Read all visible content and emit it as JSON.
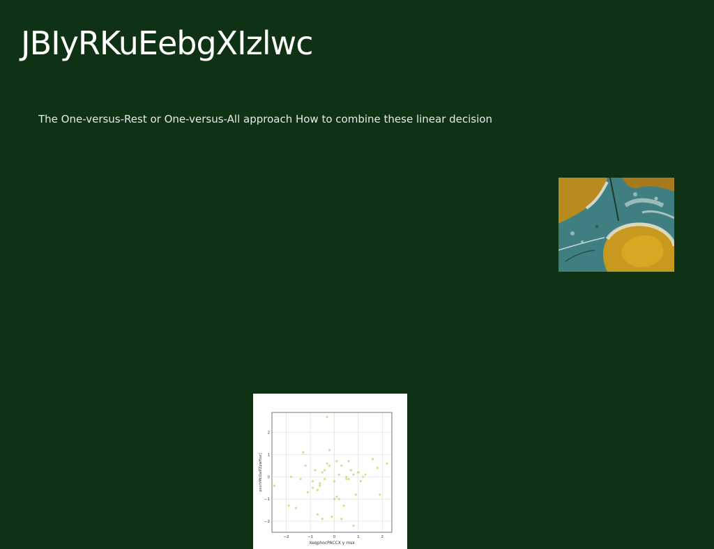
{
  "slide": {
    "title": "JBIyRKuEebgXIzlwc",
    "body": "The One-versus-Rest or One-versus-All approach How to combine these linear decision"
  },
  "photo": {
    "icon": "aerial-landscape-image",
    "colors": {
      "ochre": "#b98a1e",
      "teal": "#3f7f82",
      "white": "#e6ecea",
      "dark": "#1f3a2a"
    }
  },
  "chart_data": {
    "type": "scatter",
    "xlabel": "XeqphocPACCX y msx",
    "ylabel": "pxxrhMcOaiPZpwfhur]",
    "xlim": [
      -2.6,
      2.4
    ],
    "ylim": [
      -2.5,
      2.9
    ],
    "xticks": [
      "−2",
      "−1",
      "0",
      "1",
      "2"
    ],
    "yticks": [
      "−2",
      "−1",
      "0",
      "1",
      "2"
    ],
    "grid": true,
    "marker_color": "#c8dc78",
    "x": [
      -0.3,
      -1.3,
      -0.2,
      0.1,
      0.3,
      0.6,
      0.7,
      1.0,
      1.3,
      1.6,
      2.2,
      -2.5,
      -1.1,
      -0.9,
      -0.6,
      -0.5,
      -0.4,
      -0.2,
      0.0,
      0.2,
      0.5,
      0.8,
      1.1,
      1.8,
      -1.8,
      -1.4,
      -0.8,
      -0.6,
      -0.3,
      0.1,
      0.4,
      0.9,
      -0.1,
      -0.5,
      0.6,
      1.2,
      -1.9,
      -1.6,
      -0.7,
      0.0,
      0.3,
      0.8,
      -0.4,
      -0.7,
      -0.9,
      0.2,
      1.0,
      -1.2,
      1.9,
      0.5
    ],
    "y": [
      2.7,
      1.1,
      1.2,
      0.7,
      0.5,
      0.7,
      0.3,
      0.2,
      0.1,
      0.8,
      0.6,
      -0.4,
      -0.7,
      -0.5,
      -0.3,
      0.2,
      0.3,
      0.5,
      -0.2,
      -1.0,
      -0.1,
      0.1,
      -0.2,
      0.4,
      0.0,
      -0.1,
      0.3,
      -0.4,
      0.6,
      -0.9,
      -1.3,
      -0.8,
      -1.8,
      -1.9,
      -0.1,
      0.0,
      -1.3,
      -1.4,
      -1.7,
      -1.0,
      -1.9,
      -2.2,
      -0.1,
      -0.6,
      -0.2,
      0.1,
      0.2,
      0.5,
      -0.8,
      0.0
    ]
  }
}
